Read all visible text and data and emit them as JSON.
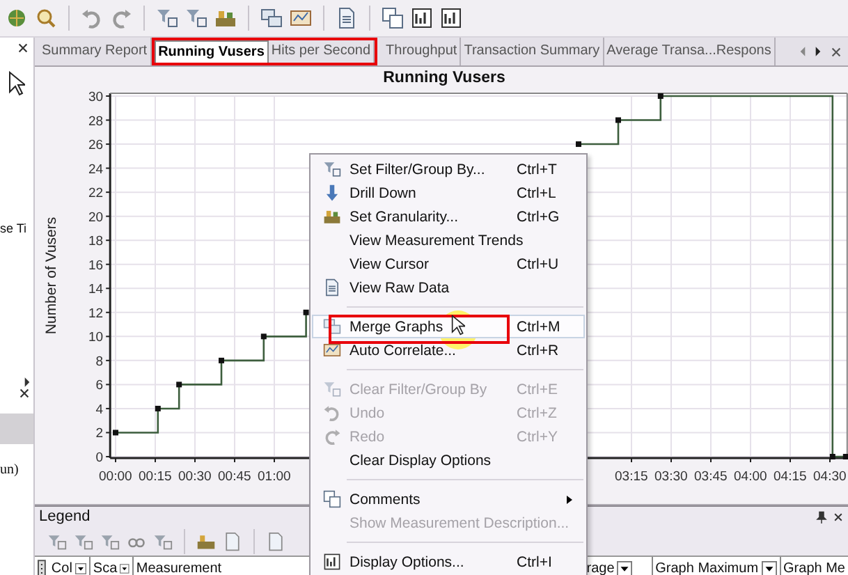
{
  "left_panel": {
    "texts": [
      "se Ti",
      "un)"
    ]
  },
  "tabs": [
    {
      "label": "Summary Report",
      "selected": false,
      "framed": false
    },
    {
      "label": "Running Vusers",
      "selected": true,
      "framed": true
    },
    {
      "label": "Hits per Second",
      "selected": false,
      "framed": true
    },
    {
      "label": "Throughput",
      "selected": false,
      "framed": false
    },
    {
      "label": "Transaction Summary",
      "selected": false,
      "framed": false
    },
    {
      "label": "Average Transa...Respons",
      "selected": false,
      "framed": false
    }
  ],
  "chart": {
    "chart_data": {
      "type": "line",
      "title": "Running Vusers",
      "ylabel": "Number of Vusers",
      "grid": true,
      "x": [
        0,
        16,
        16,
        24,
        24,
        40,
        40,
        56,
        56,
        72,
        72,
        120,
        175,
        190,
        190,
        206,
        206,
        271,
        271,
        276
      ],
      "series": [
        {
          "color": "#3d5e3d",
          "marker": "square",
          "values": [
            2,
            2,
            4,
            4,
            6,
            6,
            8,
            8,
            10,
            10,
            12,
            null,
            26,
            26,
            28,
            28,
            30,
            30,
            0,
            0
          ]
        }
      ],
      "xlim": [
        -1,
        276
      ],
      "ylim": [
        0,
        30
      ],
      "xticks": [
        {
          "value": 0,
          "label": "00:00"
        },
        {
          "value": 15,
          "label": "00:15"
        },
        {
          "value": 30,
          "label": "00:30"
        },
        {
          "value": 45,
          "label": "00:45"
        },
        {
          "value": 60,
          "label": "01:00"
        },
        {
          "value": 195,
          "label": "03:15"
        },
        {
          "value": 210,
          "label": "03:30"
        },
        {
          "value": 225,
          "label": "03:45"
        },
        {
          "value": 240,
          "label": "04:00"
        },
        {
          "value": 255,
          "label": "04:15"
        },
        {
          "value": 270,
          "label": "04:30"
        }
      ],
      "yticks": [
        0,
        2,
        4,
        6,
        8,
        10,
        12,
        14,
        16,
        18,
        20,
        22,
        24,
        26,
        28,
        30
      ]
    }
  },
  "context_menu": {
    "items": [
      {
        "kind": "item",
        "label": "Set Filter/Group By...",
        "shortcut": "Ctrl+T",
        "disabled": false,
        "highlighted": false,
        "framed": false
      },
      {
        "kind": "item",
        "label": "Drill Down",
        "shortcut": "Ctrl+L",
        "disabled": false,
        "highlighted": false,
        "framed": false
      },
      {
        "kind": "item",
        "label": "Set Granularity...",
        "shortcut": "Ctrl+G",
        "disabled": false,
        "highlighted": false,
        "framed": false
      },
      {
        "kind": "item",
        "label": "View Measurement Trends",
        "disabled": false,
        "highlighted": false,
        "framed": false
      },
      {
        "kind": "item",
        "label": "View Cursor",
        "shortcut": "Ctrl+U",
        "disabled": false,
        "highlighted": false,
        "framed": false
      },
      {
        "kind": "item",
        "label": "View Raw Data",
        "disabled": false,
        "highlighted": false,
        "framed": false
      },
      {
        "kind": "separator"
      },
      {
        "kind": "item",
        "label": "Merge Graphs",
        "shortcut": "Ctrl+M",
        "disabled": false,
        "highlighted": true,
        "framed": true
      },
      {
        "kind": "item",
        "label": "Auto Correlate...",
        "shortcut": "Ctrl+R",
        "disabled": false,
        "highlighted": false,
        "framed": false
      },
      {
        "kind": "separator"
      },
      {
        "kind": "item",
        "label": "Clear Filter/Group By",
        "shortcut": "Ctrl+E",
        "disabled": true,
        "highlighted": false,
        "framed": false
      },
      {
        "kind": "item",
        "label": "Undo",
        "shortcut": "Ctrl+Z",
        "disabled": true,
        "highlighted": false,
        "framed": false
      },
      {
        "kind": "item",
        "label": "Redo",
        "shortcut": "Ctrl+Y",
        "disabled": true,
        "highlighted": false,
        "framed": false
      },
      {
        "kind": "item",
        "label": "Clear Display Options",
        "disabled": false,
        "highlighted": false,
        "framed": false
      },
      {
        "kind": "separator"
      },
      {
        "kind": "item",
        "label": "Comments",
        "disabled": false,
        "highlighted": false,
        "framed": false,
        "submenu": true
      },
      {
        "kind": "item",
        "label": "Show Measurement Description...",
        "disabled": true,
        "highlighted": false,
        "framed": false
      },
      {
        "kind": "separator"
      },
      {
        "kind": "item",
        "label": "Display Options...",
        "shortcut": "Ctrl+I",
        "disabled": false,
        "highlighted": false,
        "framed": false
      }
    ]
  },
  "legend": {
    "title": "Legend",
    "columns": [
      {
        "label": "Col",
        "dropdown": true
      },
      {
        "label": "Sca",
        "dropdown": true
      },
      {
        "label": "Measurement",
        "dropdown": false
      },
      {
        "label": "rage",
        "dropdown": true
      },
      {
        "label": "Graph Maximum",
        "dropdown": true
      },
      {
        "label": "Graph Me",
        "dropdown": false
      }
    ]
  }
}
